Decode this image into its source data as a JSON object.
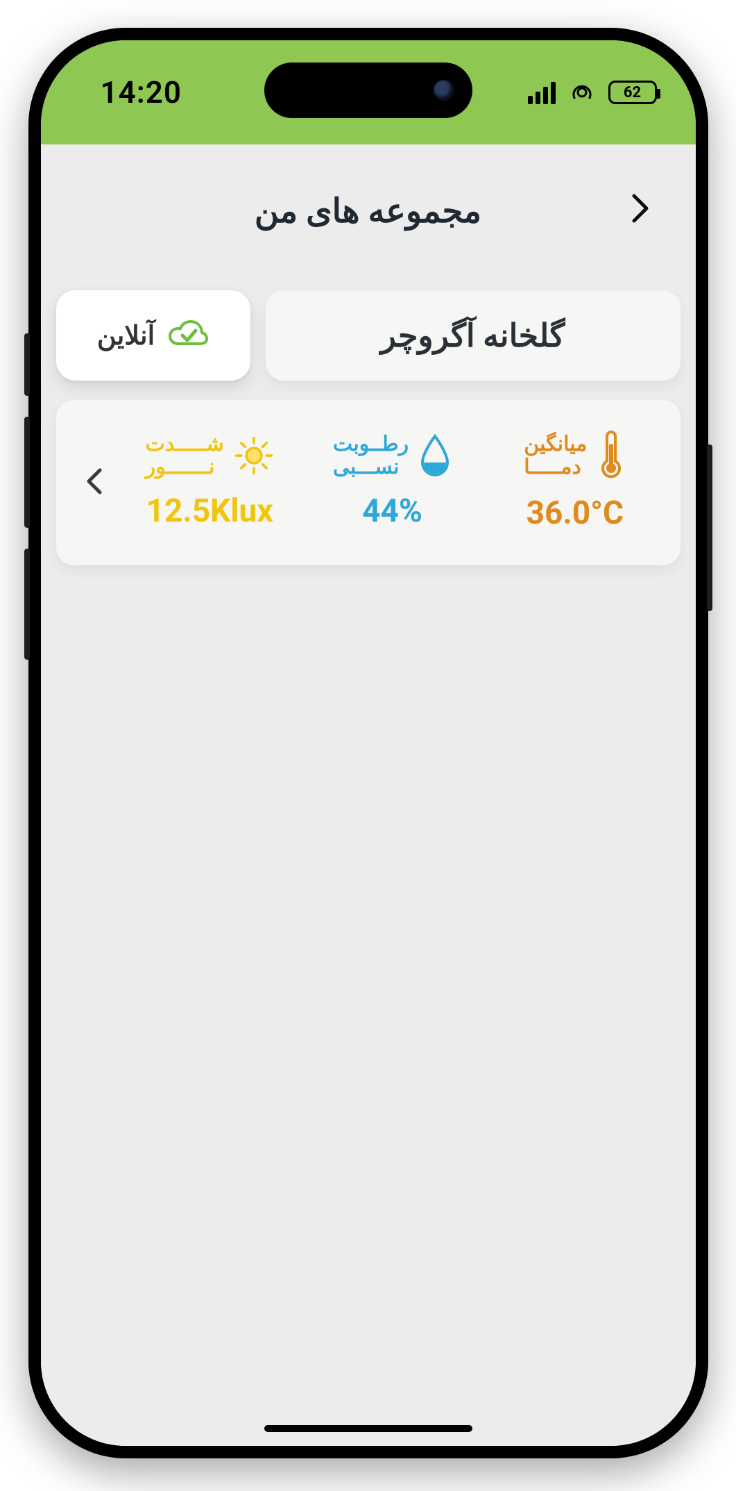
{
  "status_bar": {
    "time": "14:20",
    "battery_percent": "62"
  },
  "header": {
    "title": "مجموعه های من"
  },
  "greenhouse": {
    "name": "گلخانه آگروچر",
    "status_label": "آنلاین"
  },
  "metrics": {
    "temp": {
      "label_line1": "میانگین",
      "label_line2": "دمـــــا",
      "value": "36.0°C"
    },
    "humidity": {
      "label_line1": "رطــوبت",
      "label_line2": "نســـبی",
      "value": "44%"
    },
    "lux": {
      "label_line1": "شـــــدت",
      "label_line2": "نـــــــور",
      "value": "12.5Klux"
    }
  },
  "colors": {
    "statusbar_bg": "#8ec751",
    "app_bg": "#ececec",
    "temp": "#e08a1e",
    "humidity": "#2fa7d9",
    "lux": "#f1c40f",
    "chip_bg": "#ffffff",
    "card_bg": "#f6f6f4"
  }
}
